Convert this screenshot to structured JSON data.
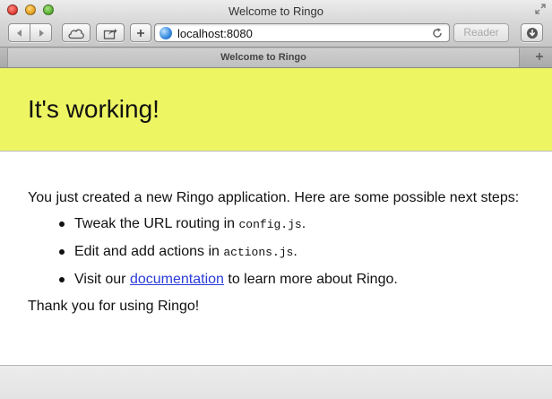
{
  "window": {
    "title": "Welcome to Ringo"
  },
  "toolbar": {
    "address_url": "localhost:8080",
    "reader_label": "Reader"
  },
  "tabs": [
    {
      "label": "Welcome to Ringo"
    }
  ],
  "page": {
    "banner_color": "#edf562",
    "heading": "It's working!",
    "intro": "You just created a new Ringo application. Here are some possible next steps:",
    "steps": [
      {
        "prefix": "Tweak the URL routing in ",
        "code": "config.js",
        "suffix": "."
      },
      {
        "prefix": "Edit and add actions in ",
        "code": "actions.js",
        "suffix": "."
      },
      {
        "prefix": "Visit our ",
        "link": "documentation",
        "suffix": " to learn more about Ringo."
      }
    ],
    "outro": "Thank you for using Ringo!"
  },
  "icons": {
    "back": "chevron-left-icon",
    "forward": "chevron-right-icon",
    "icloud": "cloud-icon",
    "share": "share-icon",
    "new_tab": "plus-icon",
    "site": "globe-icon",
    "reload": "reload-icon",
    "download": "download-icon",
    "fullscreen": "fullscreen-icon"
  }
}
